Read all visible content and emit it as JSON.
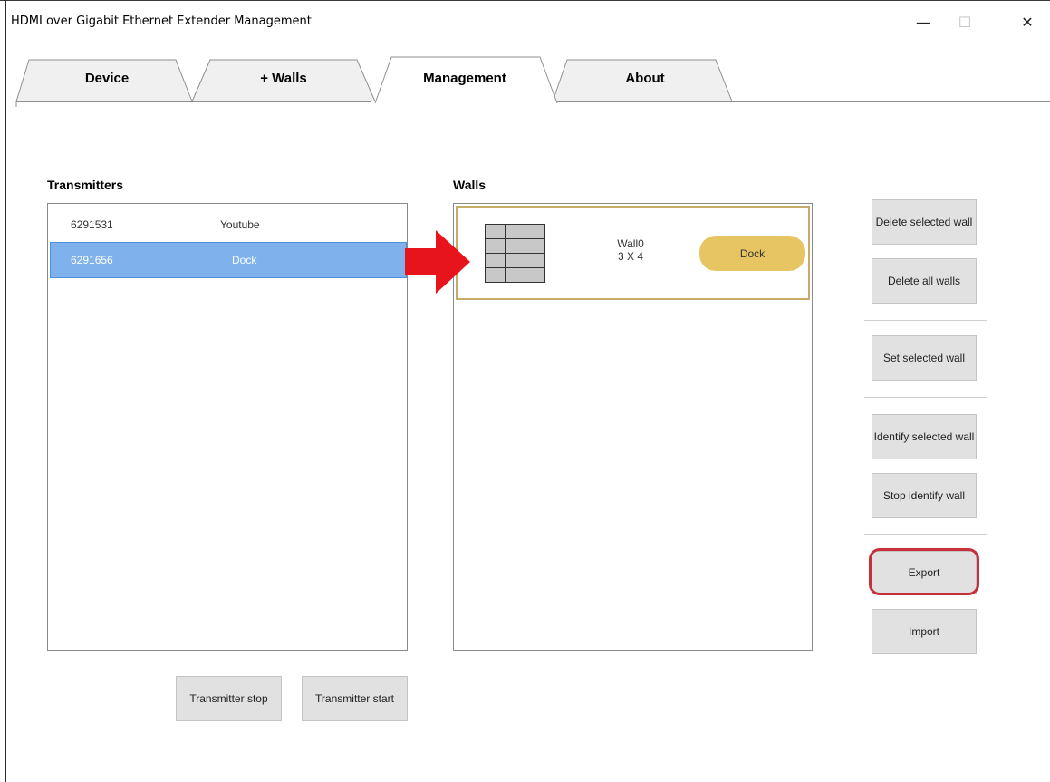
{
  "window": {
    "title": "HDMI over Gigabit Ethernet Extender Management",
    "minimize": "—",
    "maximize": "☐",
    "close": "✕"
  },
  "tabs": [
    {
      "label": "Device",
      "active": false
    },
    {
      "label": "+ Walls",
      "active": false
    },
    {
      "label": "Management",
      "active": true
    },
    {
      "label": "About",
      "active": false
    }
  ],
  "transmitters": {
    "label": "Transmitters",
    "rows": [
      {
        "id": "6291531",
        "name": "Youtube",
        "selected": false
      },
      {
        "id": "6291656",
        "name": "Dock",
        "selected": true
      }
    ],
    "stop_label": "Transmitter stop",
    "start_label": "Transmitter start"
  },
  "walls": {
    "label": "Walls",
    "items": [
      {
        "name": "Wall0",
        "size": "3 X 4",
        "dock_label": "Dock",
        "grid_icon": "grid-3x4-icon"
      }
    ]
  },
  "actions": {
    "delete_selected": "Delete selected wall",
    "delete_all": "Delete all walls",
    "set_selected": "Set selected wall",
    "identify_selected": "Identify selected wall",
    "stop_identify": "Stop identify wall",
    "export": "Export",
    "import": "Import"
  },
  "colors": {
    "selection": "#7fb2ec",
    "dock_button": "#e8c563",
    "wall_border": "#c7ab6a",
    "arrow": "#e8141c",
    "highlight_ring": "#c5303a",
    "button_bg": "#e1e1e1"
  }
}
